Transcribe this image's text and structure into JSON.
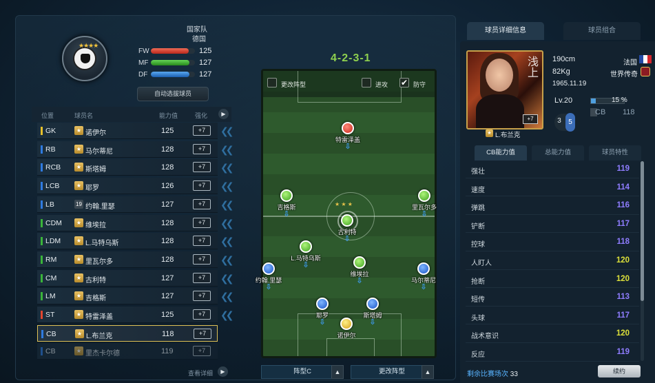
{
  "team": {
    "type": "国家队",
    "name": "德国",
    "stats": [
      {
        "label": "FW",
        "value": "125",
        "color": "#e2462f",
        "fill": 0.86
      },
      {
        "label": "MF",
        "value": "127",
        "color": "#3ab43a",
        "fill": 0.88
      },
      {
        "label": "DF",
        "value": "127",
        "color": "#2a82d8",
        "fill": 0.88
      }
    ],
    "auto_button": "自动选拔球员"
  },
  "list": {
    "headers": {
      "pos": "位置",
      "name": "球员名",
      "rating": "能力值",
      "enhance": "强化"
    },
    "rows": [
      {
        "pos": "GK",
        "name": "诺伊尔",
        "rating": "125",
        "enh": "+7",
        "color": "#e6c02b",
        "star": "★"
      },
      {
        "pos": "RB",
        "name": "马尔蒂尼",
        "rating": "128",
        "enh": "+7",
        "color": "#2f7be0",
        "star": "★"
      },
      {
        "pos": "RCB",
        "name": "斯塔姆",
        "rating": "128",
        "enh": "+7",
        "color": "#2f7be0",
        "star": "★"
      },
      {
        "pos": "LCB",
        "name": "耶罗",
        "rating": "126",
        "enh": "+7",
        "color": "#2f7be0",
        "star": "★"
      },
      {
        "pos": "LB",
        "name": "约翰.里瑟",
        "rating": "127",
        "enh": "+7",
        "color": "#2f7be0",
        "star": "19"
      },
      {
        "pos": "CDM",
        "name": "维埃拉",
        "rating": "128",
        "enh": "+7",
        "color": "#3ab43a",
        "star": "★"
      },
      {
        "pos": "LDM",
        "name": "L.马特乌斯",
        "rating": "128",
        "enh": "+7",
        "color": "#3ab43a",
        "star": "★"
      },
      {
        "pos": "RM",
        "name": "里瓦尔多",
        "rating": "128",
        "enh": "+7",
        "color": "#3ab43a",
        "star": "★"
      },
      {
        "pos": "CM",
        "name": "古利特",
        "rating": "127",
        "enh": "+7",
        "color": "#3ab43a",
        "star": "★"
      },
      {
        "pos": "LM",
        "name": "吉格斯",
        "rating": "127",
        "enh": "+7",
        "color": "#3ab43a",
        "star": "★"
      },
      {
        "pos": "ST",
        "name": "特雷泽盖",
        "rating": "125",
        "enh": "+7",
        "color": "#e2462f",
        "star": "★"
      },
      {
        "pos": "CB",
        "name": "L.布兰克",
        "rating": "118",
        "enh": "+7",
        "color": "#2f7be0",
        "star": "★"
      },
      {
        "pos": "CB",
        "name": "里杰卡尔德",
        "rating": "119",
        "enh": "+7",
        "color": "#2f7be0",
        "star": "★"
      }
    ],
    "detail_link": "查看详细"
  },
  "pitch": {
    "formation": "4-2-3-1",
    "change_formation_label": "更改阵型",
    "attack_label": "进攻",
    "defense_label": "防守",
    "players": [
      {
        "name": "特雷泽盖",
        "ball": "r"
      },
      {
        "name": "吉格斯",
        "ball": "g"
      },
      {
        "name": "里瓦尔多",
        "ball": "g"
      },
      {
        "name": "古利特",
        "ball": "g"
      },
      {
        "name": "L.马特乌斯",
        "ball": "g"
      },
      {
        "name": "维埃拉",
        "ball": "g"
      },
      {
        "name": "约翰.里瑟",
        "ball": "b"
      },
      {
        "name": "马尔蒂尼",
        "ball": "b"
      },
      {
        "name": "耶罗",
        "ball": "b"
      },
      {
        "name": "斯塔姆",
        "ball": "b"
      },
      {
        "name": "诺伊尔",
        "ball": "y"
      }
    ],
    "bottom_left": "阵型C",
    "bottom_right": "更改阵型"
  },
  "detail": {
    "tab_active": "球员详细信息",
    "tab_inactive": "球员组合",
    "photo_text": "浅上",
    "photo_badge": "+7",
    "height": "190cm",
    "weight": "82Kg",
    "birth": "1965.11.19",
    "country": "法国",
    "tag": "世界传奇",
    "level": "Lv.20",
    "progress": "15 %",
    "progress_value": 0.15,
    "pos": "CB",
    "pos_rating": "118",
    "pill_a": "3",
    "pill_b": "5",
    "player_name": "L.布兰克",
    "subtabs": [
      "CB能力值",
      "总能力值",
      "球员特性"
    ],
    "stats": [
      {
        "name": "强壮",
        "value": "119",
        "color": "#8f7dff"
      },
      {
        "name": "速度",
        "value": "114",
        "color": "#8f7dff"
      },
      {
        "name": "弹跳",
        "value": "116",
        "color": "#8f7dff"
      },
      {
        "name": "铲断",
        "value": "117",
        "color": "#8f7dff"
      },
      {
        "name": "控球",
        "value": "118",
        "color": "#8f7dff"
      },
      {
        "name": "人盯人",
        "value": "120",
        "color": "#dce03a"
      },
      {
        "name": "抢断",
        "value": "120",
        "color": "#dce03a"
      },
      {
        "name": "短传",
        "value": "113",
        "color": "#8f7dff"
      },
      {
        "name": "头球",
        "value": "117",
        "color": "#8f7dff"
      },
      {
        "name": "战术意识",
        "value": "120",
        "color": "#dce03a"
      },
      {
        "name": "反应",
        "value": "119",
        "color": "#8f7dff"
      }
    ],
    "remain_label": "剩余比赛场次",
    "remain_value": "33",
    "renew_button": "续约"
  }
}
